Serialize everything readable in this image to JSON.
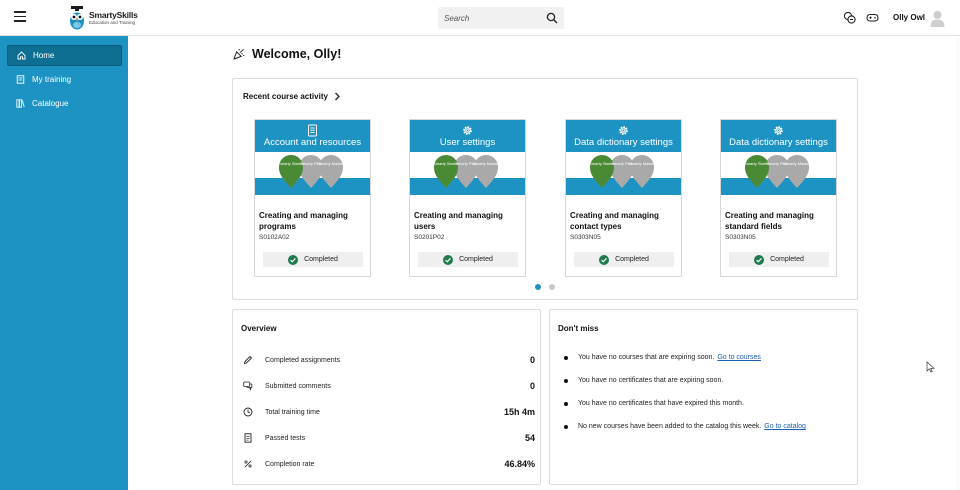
{
  "header": {
    "logo_title": "SmartySkills",
    "logo_subtitle": "Education and Training",
    "search_placeholder": "Search",
    "user_name": "Olly Owl"
  },
  "sidebar": {
    "items": [
      {
        "label": "Home",
        "icon": "home-icon",
        "active": true
      },
      {
        "label": "My training",
        "icon": "training-icon",
        "active": false
      },
      {
        "label": "Catalogue",
        "icon": "catalogue-icon",
        "active": false
      }
    ]
  },
  "welcome": "Welcome, Olly!",
  "recent": {
    "title": "Recent course activity",
    "courses": [
      {
        "banner": "Account and resources",
        "banner_icon": "document-icon",
        "name": "Creating and managing programs",
        "code": "S0102A02",
        "status": "Completed",
        "pins": [
          "Smarty Starter",
          "Smarty Plus",
          "Smarty Master"
        ]
      },
      {
        "banner": "User settings",
        "banner_icon": "gear-icon",
        "name": "Creating and managing users",
        "code": "S0201P02",
        "status": "Completed",
        "pins": [
          "Smarty Starter",
          "Smarty Plus",
          "Smarty Master"
        ]
      },
      {
        "banner": "Data dictionary settings",
        "banner_icon": "gear-icon",
        "name": "Creating and managing contact types",
        "code": "S0303N05",
        "status": "Completed",
        "pins": [
          "Smarty Starter",
          "Smarty Plus",
          "Smarty Master"
        ]
      },
      {
        "banner": "Data dictionary settings",
        "banner_icon": "gear-icon",
        "name": "Creating and managing standard fields",
        "code": "S0303N05",
        "status": "Completed",
        "pins": [
          "Smarty Starter",
          "Smarty Plus",
          "Smarty Master"
        ]
      }
    ]
  },
  "overview": {
    "title": "Overview",
    "rows": [
      {
        "label": "Completed assignments",
        "value": "0",
        "icon": "pencil-icon"
      },
      {
        "label": "Submitted comments",
        "value": "0",
        "icon": "comments-icon"
      },
      {
        "label": "Total training time",
        "value": "15h 4m",
        "icon": "clock-icon"
      },
      {
        "label": "Passed tests",
        "value": "54",
        "icon": "test-document-icon"
      },
      {
        "label": "Completion rate",
        "value": "46.84%",
        "icon": "percent-icon"
      }
    ]
  },
  "dont_miss": {
    "title": "Don't miss",
    "items": [
      {
        "text": "You have no courses that are expiring soon.",
        "link": "Go to courses"
      },
      {
        "text": "You have no certificates that are expiring soon.",
        "link": ""
      },
      {
        "text": "You have no certificates that have expired this month.",
        "link": ""
      },
      {
        "text": "No new courses have been added to the catalog this week.",
        "link": "Go to catalog"
      }
    ]
  },
  "colors": {
    "brand_blue": "#1c93c2",
    "sidebar_active": "#0f6f93",
    "pin_green": "#4a8a35",
    "pin_gray": "#a9a9a9",
    "check_green": "#1f7a4d",
    "dot_active": "#1c93c2",
    "dot_inactive": "#c9c9c9"
  }
}
